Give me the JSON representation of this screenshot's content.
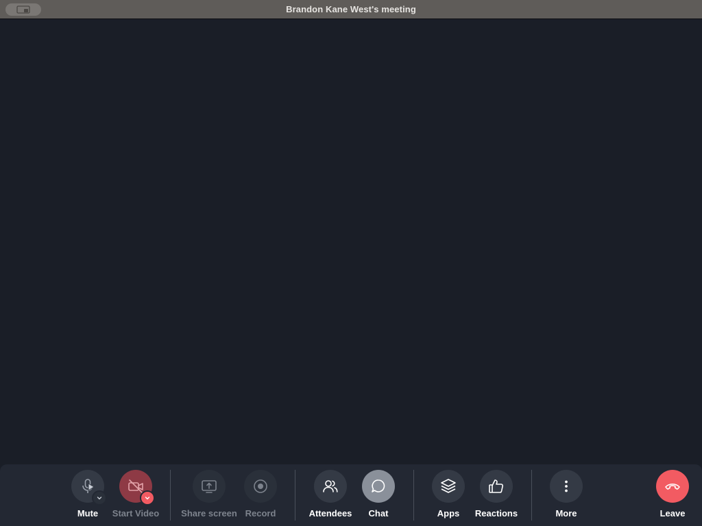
{
  "window": {
    "title": "Brandon Kane West's meeting"
  },
  "toolbar": {
    "mute": {
      "label": "Mute",
      "icon": "microphone-icon"
    },
    "start_video": {
      "label": "Start Video",
      "icon": "video-off-icon"
    },
    "share_screen": {
      "label": "Share screen",
      "icon": "share-screen-icon"
    },
    "record": {
      "label": "Record",
      "icon": "record-icon"
    },
    "attendees": {
      "label": "Attendees",
      "icon": "attendees-icon"
    },
    "chat": {
      "label": "Chat",
      "icon": "chat-icon"
    },
    "apps": {
      "label": "Apps",
      "icon": "apps-layers-icon"
    },
    "reactions": {
      "label": "Reactions",
      "icon": "thumbs-up-icon"
    },
    "more": {
      "label": "More",
      "icon": "more-vertical-icon"
    },
    "leave": {
      "label": "Leave",
      "icon": "hang-up-icon"
    }
  },
  "colors": {
    "titlebar": "#5f5c59",
    "stage": "#1a1e27",
    "toolbar": "#232833",
    "leave": "#f25b62",
    "video_off": "#8e3a45"
  }
}
